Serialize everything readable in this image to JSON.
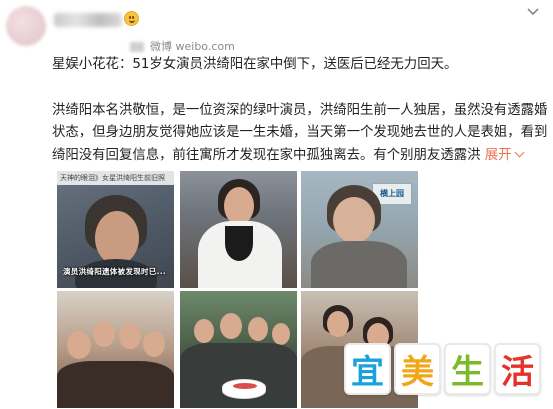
{
  "post": {
    "author_meta": "微博 weibo.com",
    "headline_prefix": "星娱小花花：",
    "headline": "51岁女演员洪绮阳在家中倒下，送医后已经无力回天。",
    "body_lines": [
      "洪绮阳本名洪敬恒，是一位资深的绿叶演员，洪绮阳生前一人独居，虽然没有透露婚姻",
      "状态，但身边朋友觉得她应该是一生未婚，当天第一个发现她去世的人是表姐，看到洪",
      "绮阳没有回复信息，前往寓所才发现在家中孤独离去。有个别朋友透露洪"
    ],
    "expand_label": "展开",
    "colors": {
      "accent": "#eb7350",
      "text": "#222222",
      "meta": "#8a8a8a"
    }
  },
  "photos": [
    {
      "caption": "天神的眼泪》女星洪绮阳生前旧照",
      "subtitle": "演员洪绮阳遗体被发现时已..."
    },
    {
      "caption": ""
    },
    {
      "sign_text": "横上园"
    },
    {
      "caption": ""
    },
    {
      "caption": ""
    },
    {
      "caption": ""
    }
  ],
  "watermark": {
    "chars": [
      "宜",
      "美",
      "生",
      "活"
    ]
  }
}
